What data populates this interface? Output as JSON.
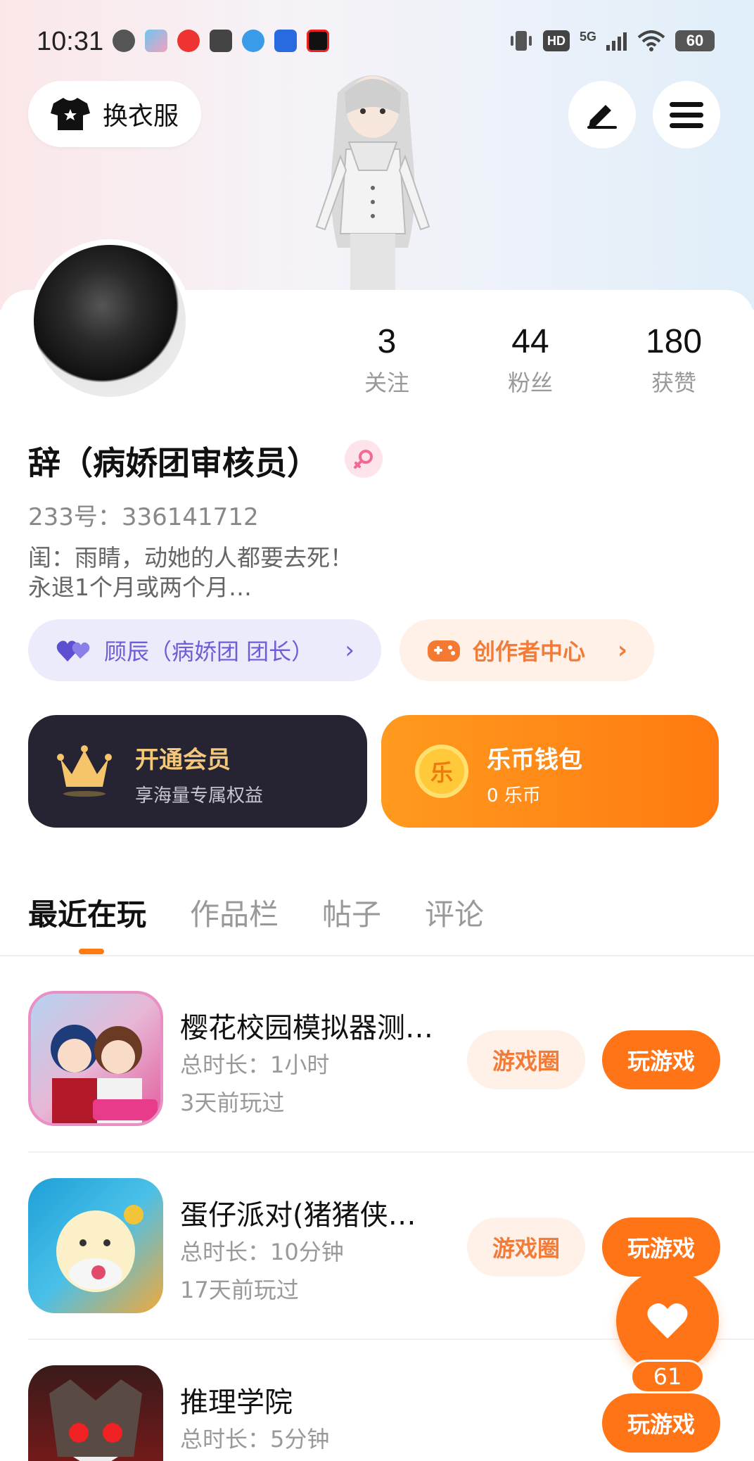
{
  "status_bar": {
    "time": "10:31",
    "network": "5G",
    "hd_label": "HD",
    "battery": "60"
  },
  "header": {
    "outfit_label": "换衣服",
    "edit_icon": "pen-icon",
    "menu_icon": "hamburger-icon"
  },
  "stats": [
    {
      "value": "3",
      "label": "关注"
    },
    {
      "value": "44",
      "label": "粉丝"
    },
    {
      "value": "180",
      "label": "获赞"
    }
  ],
  "profile": {
    "name": "辞（病娇团审核员）",
    "id": "233号：336141712",
    "bio": "闺：雨睛，动她的人都要去死！\n永退1个月或两个月…"
  },
  "pills": [
    {
      "label": "顾辰（病娇团 团长）",
      "chevron": "›"
    },
    {
      "label": "创作者中心",
      "chevron": "›"
    }
  ],
  "vip": {
    "title": "开通会员",
    "subtitle": "享海量专属权益"
  },
  "wallet": {
    "title": "乐币钱包",
    "subtitle": "0 乐币",
    "coin_label": "乐"
  },
  "tabs": [
    "最近在玩",
    "作品栏",
    "帖子",
    "评论"
  ],
  "games": [
    {
      "name": "樱花校园模拟器测…",
      "duration": "总时长：1小时",
      "last_played": "3天前玩过",
      "circle_label": "游戏圈",
      "play_label": "玩游戏"
    },
    {
      "name": "蛋仔派对(猪猪侠…",
      "duration": "总时长：10分钟",
      "last_played": "17天前玩过",
      "circle_label": "游戏圈",
      "play_label": "玩游戏"
    },
    {
      "name": "推理学院",
      "duration": "总时长：5分钟",
      "last_played": "",
      "circle_label": "",
      "play_label": "玩游戏"
    }
  ],
  "fab": {
    "count": "61"
  },
  "colors": {
    "accent": "#ff7416",
    "vip_bg": "#262433",
    "vip_gold": "#f4c87a",
    "pill_purple_bg": "#ecebfb",
    "pill_purple_text": "#6b5ed6",
    "pill_orange_bg": "#fff0e8",
    "pill_orange_text": "#f17c3a"
  }
}
